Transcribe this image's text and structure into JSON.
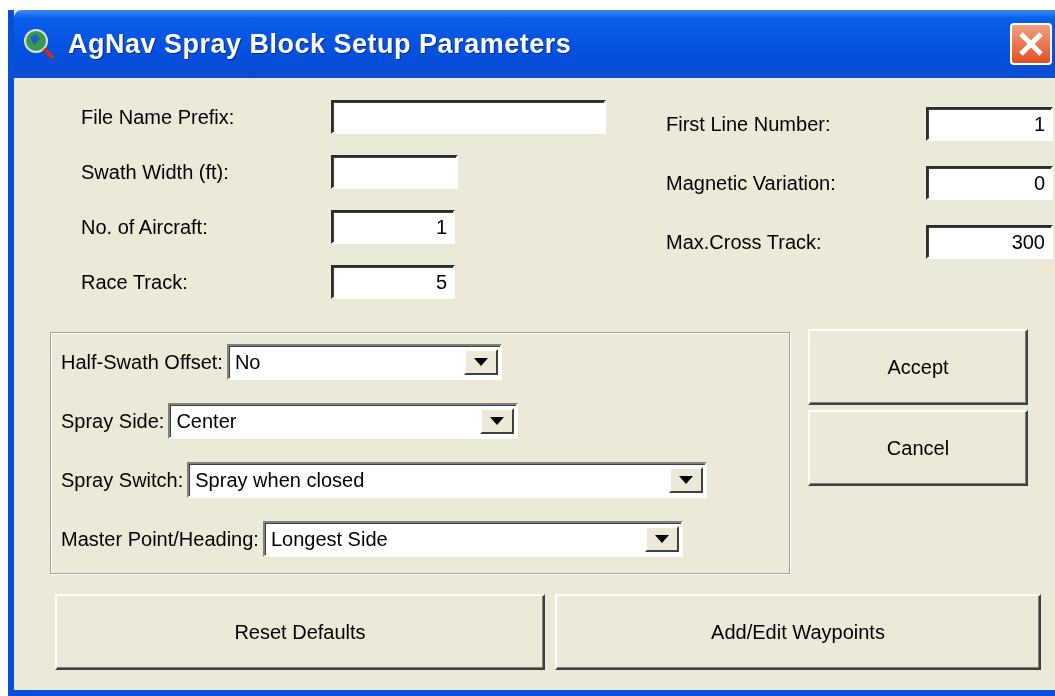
{
  "window": {
    "title": "AgNav Spray Block Setup Parameters"
  },
  "left_fields": [
    {
      "label": "File Name Prefix:"
    },
    {
      "label": "Swath Width (ft):"
    },
    {
      "label": "No. of Aircraft:",
      "value": "1"
    },
    {
      "label": "Race Track:",
      "value": "5"
    }
  ],
  "right_fields": [
    {
      "label": "First Line Number:",
      "value": "1"
    },
    {
      "label": "Magnetic Variation:",
      "value": "0"
    },
    {
      "label": "Max.Cross Track:",
      "value": "300"
    }
  ],
  "dropdowns": [
    {
      "label": "Half-Swath Offset:",
      "value": "No"
    },
    {
      "label": "Spray Side:",
      "value": "Center"
    },
    {
      "label": "Spray Switch:",
      "value": "Spray when closed"
    },
    {
      "label": "Master Point/Heading:",
      "value": "Longest Side"
    }
  ],
  "side_buttons": [
    "Accept",
    "Cancel"
  ],
  "bottom_buttons": [
    "Reset Defaults",
    "Add/Edit Waypoints"
  ]
}
